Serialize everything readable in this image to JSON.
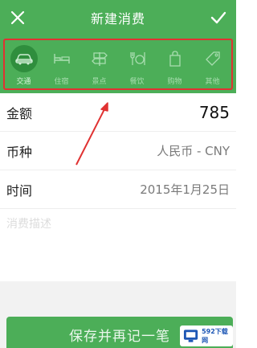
{
  "header": {
    "title": "新建消费",
    "close_icon": "close-icon",
    "confirm_icon": "check-icon"
  },
  "categories": [
    {
      "label": "交通",
      "icon": "car-icon",
      "active": true
    },
    {
      "label": "住宿",
      "icon": "bed-icon",
      "active": false
    },
    {
      "label": "景点",
      "icon": "signpost-icon",
      "active": false
    },
    {
      "label": "餐饮",
      "icon": "dining-icon",
      "active": false
    },
    {
      "label": "购物",
      "icon": "shopping-bag-icon",
      "active": false
    },
    {
      "label": "其他",
      "icon": "tag-icon",
      "active": false
    }
  ],
  "form": {
    "amount_label": "金额",
    "amount_value": "785",
    "currency_label": "币种",
    "currency_value": "人民币 - CNY",
    "time_label": "时间",
    "time_value": "2015年1月25日",
    "description_placeholder": "消费描述"
  },
  "actions": {
    "save_again_label": "保存并再记一笔"
  },
  "watermark": {
    "text": "592下载网"
  },
  "colors": {
    "primary": "#4cae58",
    "active_icon_bg": "#2f8e3d",
    "annotation": "#e03232"
  }
}
